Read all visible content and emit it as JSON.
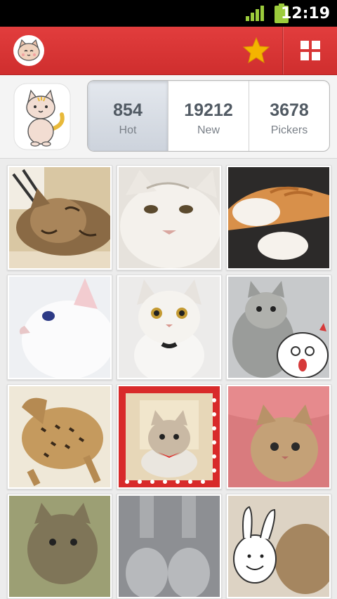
{
  "status_bar": {
    "time": "12:19"
  },
  "action_bar": {
    "logo_icon": "cat-face-icon",
    "favorite_icon": "star-icon",
    "menu_icon": "grid-icon",
    "colors": {
      "bar": "#d93636",
      "star": "#f4b400"
    }
  },
  "profile": {
    "avatar_icon": "cat-mascot-icon",
    "stats": [
      {
        "value": "854",
        "label": "Hot"
      },
      {
        "value": "19212",
        "label": "New"
      },
      {
        "value": "3678",
        "label": "Pickers"
      }
    ],
    "selected_index": 0
  },
  "photos": [
    {
      "subject": "bengal-cat-sleeping"
    },
    {
      "subject": "white-cat-closeup"
    },
    {
      "subject": "orange-white-cat-paws"
    },
    {
      "subject": "white-cat-profile"
    },
    {
      "subject": "white-cat-bow-collar"
    },
    {
      "subject": "tabby-cat-with-sticker"
    },
    {
      "subject": "bengal-cat-standing"
    },
    {
      "subject": "tabby-kitten-red-bow"
    },
    {
      "subject": "tabby-kitten-pink-blanket"
    },
    {
      "subject": "tabby-cat-greenish"
    },
    {
      "subject": "gray-cat-paws"
    },
    {
      "subject": "cat-with-bunny-sticker"
    }
  ]
}
